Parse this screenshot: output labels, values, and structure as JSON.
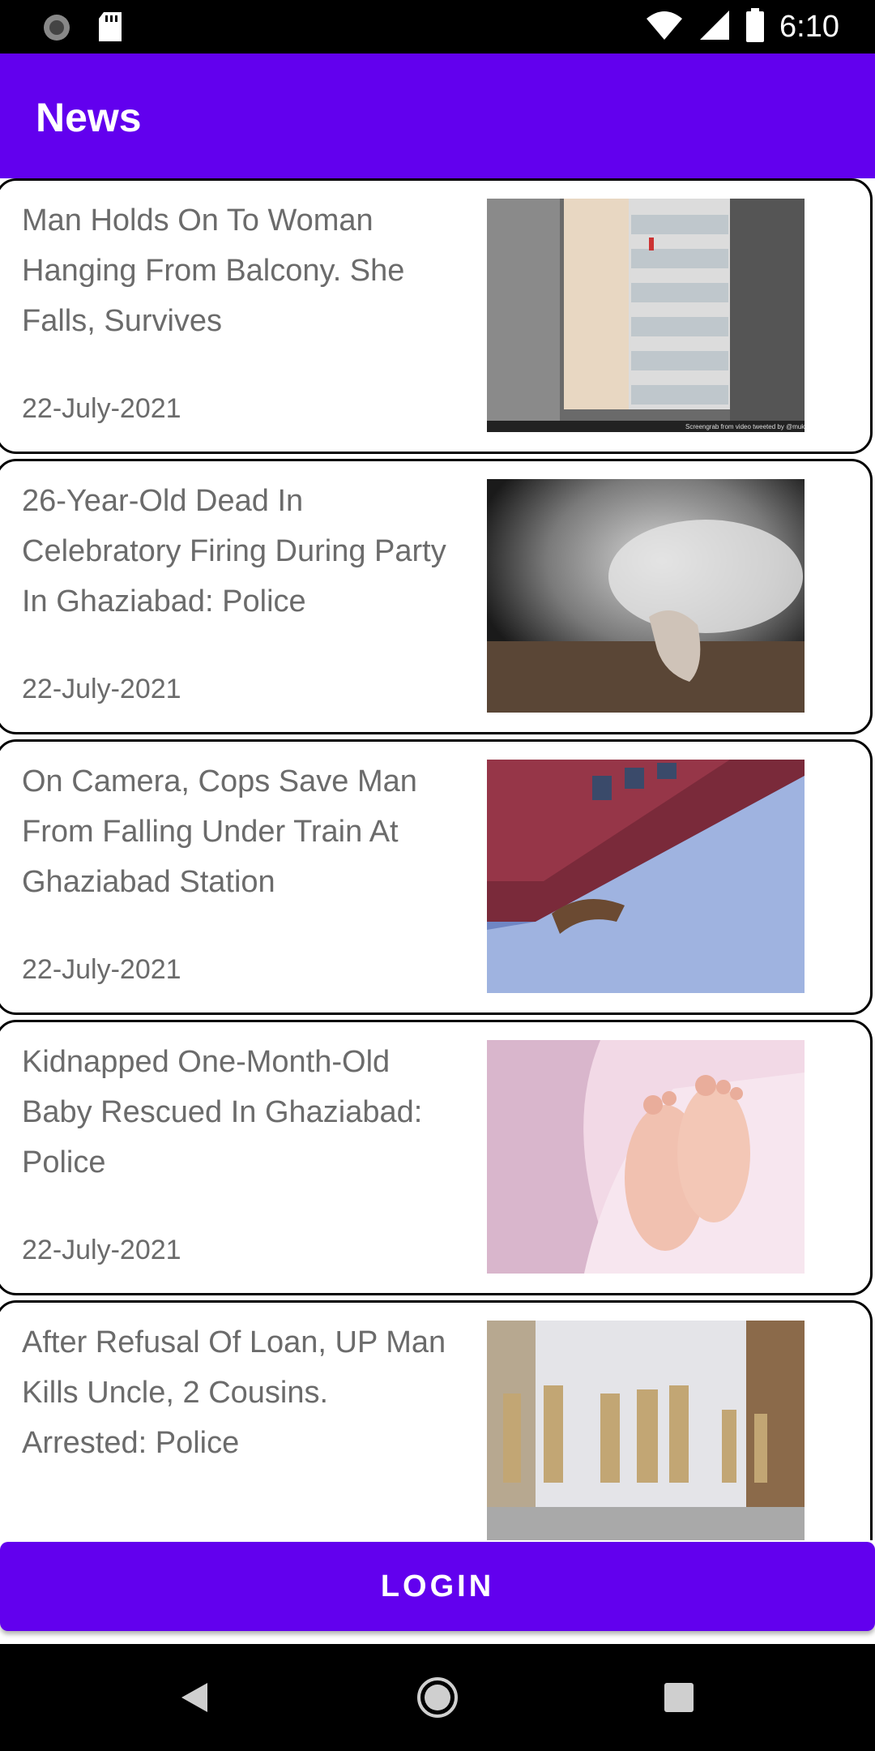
{
  "status_bar": {
    "time": "6:10",
    "icons": [
      "sync-icon",
      "sd-card-icon",
      "wifi-icon",
      "signal-icon",
      "battery-icon"
    ]
  },
  "app_bar": {
    "title": "News",
    "color": "#6200EE"
  },
  "news": [
    {
      "title": "Man Holds On To Woman Hanging From Balcony. She Falls, Survives",
      "date": "22-July-2021",
      "image": "building-balcony-photo",
      "caption": "Screengrab from video tweeted by @mukeshmukesha"
    },
    {
      "title": "26-Year-Old Dead In Celebratory Firing During Party In Ghaziabad: Police",
      "date": "22-July-2021",
      "image": "body-under-sheet-photo"
    },
    {
      "title": "On Camera, Cops Save Man From Falling Under Train At Ghaziabad Station",
      "date": "22-July-2021",
      "image": "train-platform-photo"
    },
    {
      "title": "Kidnapped One-Month-Old Baby Rescued In Ghaziabad: Police",
      "date": "22-July-2021",
      "image": "baby-feet-photo"
    },
    {
      "title": "After Refusal Of Loan, UP Man Kills Uncle, 2 Cousins. Arrested: Police",
      "date": "",
      "image": "police-street-photo"
    }
  ],
  "login_button": {
    "label": "LOGIN"
  },
  "nav_bar": {
    "icons": [
      "back-icon",
      "home-icon",
      "recents-icon"
    ]
  }
}
